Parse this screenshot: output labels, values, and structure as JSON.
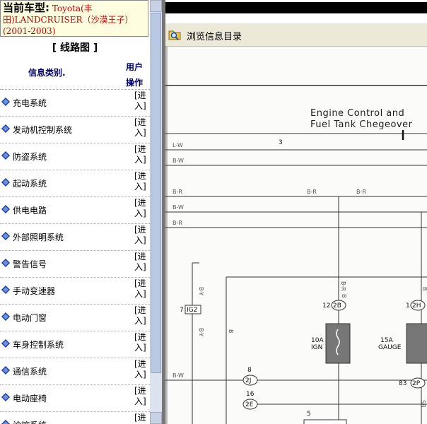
{
  "vehicle": {
    "label": "当前车型:",
    "model_line1": " Toyota(丰",
    "model_line2": "田)LANDCRUISER（沙漠王子）",
    "years": "(2001-2003)"
  },
  "panel_title": "[ 线路图 ]",
  "table": {
    "col_category": "信息类别.",
    "col_action_line1": "用户",
    "col_action_line2": "操作"
  },
  "rows": [
    {
      "name": "充电系统",
      "action": "[进入]"
    },
    {
      "name": "发动机控制系统",
      "action": "[进入]"
    },
    {
      "name": "防盗系统",
      "action": "[进入]"
    },
    {
      "name": "起动系统",
      "action": "[进入]"
    },
    {
      "name": "供电电路",
      "action": "[进入]"
    },
    {
      "name": "外部照明系统",
      "action": "[进入]"
    },
    {
      "name": "警告信号",
      "action": "[进入]"
    },
    {
      "name": "手动变速器",
      "action": "[进入]"
    },
    {
      "name": "电动门窗",
      "action": "[进入]"
    },
    {
      "name": "车身控制系统",
      "action": "[进入]"
    },
    {
      "name": "通信系统",
      "action": "[进入]"
    },
    {
      "name": "电动座椅",
      "action": "[进入]"
    },
    {
      "name": "诊控系统",
      "action": "[进入]"
    }
  ],
  "toolbar": {
    "browse_label": "浏览信息目录",
    "icon": "folder-search-icon"
  },
  "diagram": {
    "title_line1": "Engine Control and",
    "title_line2": "Fuel Tank Chegeover",
    "number": "3",
    "wires": [
      "L-W",
      "B-W",
      "B-R",
      "B-W",
      "B-R",
      "B-R",
      "B-R",
      "B-Y",
      "B-Y",
      "B",
      "B-W",
      "B-R",
      "B",
      "SB",
      "B"
    ],
    "connectors": [
      "IG2",
      "2B",
      "2H",
      "2J",
      "2E",
      "2P"
    ],
    "pins": [
      "7",
      "12",
      "1",
      "8",
      "16",
      "83",
      "5"
    ],
    "fuse1_rating": "10A",
    "fuse1_name": "IGN",
    "fuse2_rating": "15A",
    "fuse2_name": "GAUGE"
  },
  "colors": {
    "vehicle_text": "#c00000",
    "header_text": "#000066",
    "row_icon": "#1a3ea8",
    "toolbar_bg": "#ece9d8"
  }
}
